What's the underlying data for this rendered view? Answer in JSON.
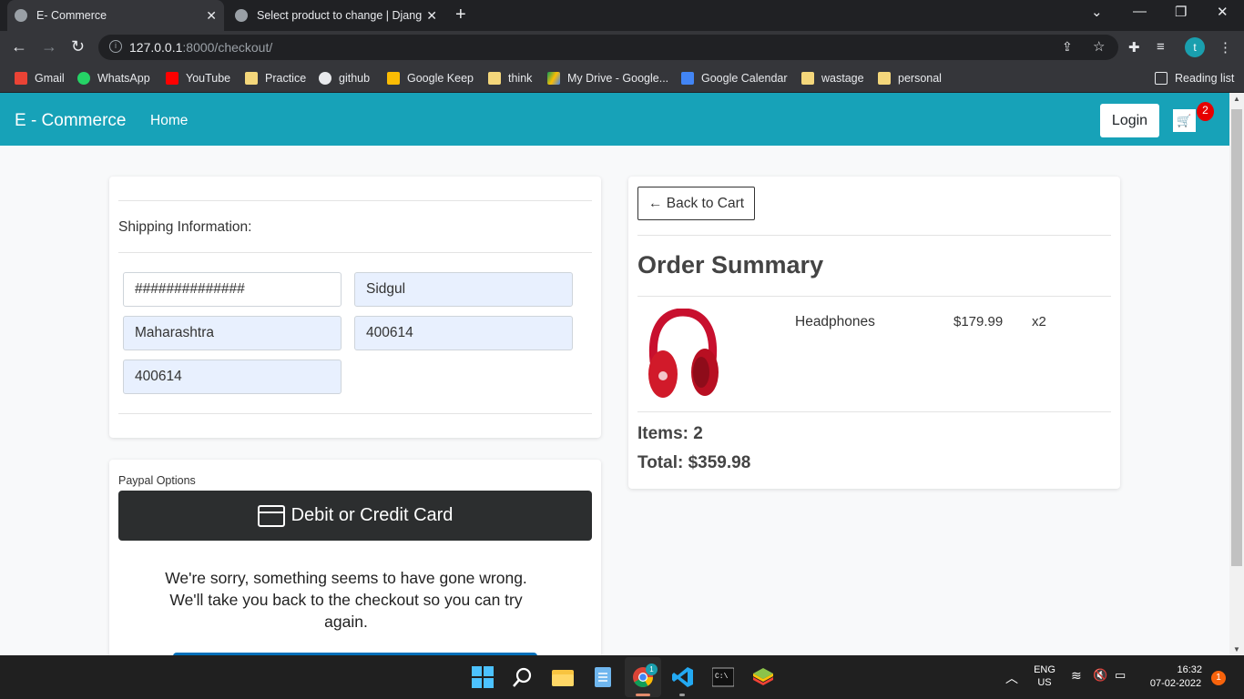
{
  "browser": {
    "tabs": [
      {
        "title": "E- Commerce",
        "active": true
      },
      {
        "title": "Select product to change | Djang",
        "active": false
      }
    ],
    "url_host": "127.0.0.1",
    "url_path": ":8000/checkout/",
    "profile_initial": "t",
    "bookmarks": [
      "Gmail",
      "WhatsApp",
      "YouTube",
      "Practice",
      "github",
      "Google Keep",
      "think",
      "My Drive - Google...",
      "Google Calendar",
      "wastage",
      "personal"
    ],
    "reading_list": "Reading list"
  },
  "site": {
    "brand": "E - Commerce",
    "nav_home": "Home",
    "login": "Login",
    "cart_count": "2"
  },
  "shipping": {
    "title": "Shipping Information:",
    "fields": {
      "address": "##############",
      "city": "Sidgul",
      "state": "Maharashtra",
      "zipcode": "400614",
      "country": "400614"
    }
  },
  "paypal": {
    "label": "Paypal Options",
    "card_button": "Debit or Credit Card",
    "error_message": "We're sorry, something seems to have gone wrong. We'll take you back to the checkout so you can try again."
  },
  "summary": {
    "back_button": "← Back to Cart",
    "title": "Order Summary",
    "item": {
      "name": "Headphones",
      "price": "$179.99",
      "qty": "x2"
    },
    "items_line": "Items: 2",
    "total_line": "Total: $359.98"
  },
  "taskbar": {
    "lang": "ENG",
    "region": "US",
    "time": "16:32",
    "date": "07-02-2022",
    "notification_count": "1",
    "chrome_badge": "1"
  },
  "colors": {
    "navbar": "#17a2b8",
    "badge": "#e60000",
    "paypal_dark": "#2c2e2f"
  }
}
